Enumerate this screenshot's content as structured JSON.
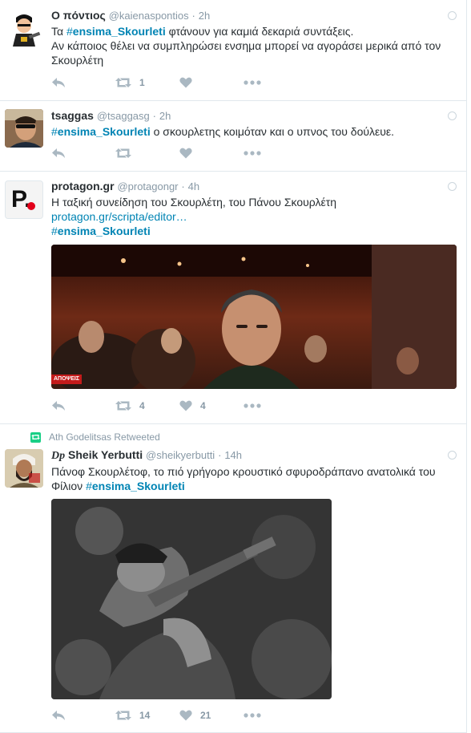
{
  "tweets": [
    {
      "name": "Ο πόντιος",
      "handle": "@kaienaspontios",
      "dot": "·",
      "time": "2h",
      "text_before": "Τα ",
      "hashtag_hash": "#",
      "hashtag": "ensima_Skourleti",
      "text_after": " φτάνουν για καμιά δεκαριά συντάξεις.",
      "text_line2": "Αν κάποιος θέλει να συμπληρώσει ενσημα μπορεί να αγοράσει μερικά από τον Σκουρλέτη",
      "retweets": "1",
      "likes": ""
    },
    {
      "name": "tsaggas",
      "handle": "@tsaggasg",
      "dot": "·",
      "time": "2h",
      "hashtag_hash": "#",
      "hashtag": "ensima_Skourleti",
      "text_after": " ο σκουρλετης κοιμόταν και ο υπνος του δούλευε.",
      "retweets": "",
      "likes": ""
    },
    {
      "name": "protagon.gr",
      "handle": "@protagongr",
      "dot": "·",
      "time": "4h",
      "text_line1": "Η ταξική συνείδηση του Σκουρλέτη, του Πάνου Σκουρλέτη",
      "link": "protagon.gr/scripta/editor…",
      "hashtag_hash": "#",
      "hashtag": "ensima_Skourleti",
      "image_badge": "ΑΠΟΨΕΙΣ",
      "retweets": "4",
      "likes": "4"
    },
    {
      "retweeted_by": "Ath Godelitsas Retweeted",
      "name_prefix": "Dp",
      "name": "Sheik Yerbutti",
      "handle": "@sheikyerbutti",
      "dot": "·",
      "time": "14h",
      "text_before": "Πάνοφ Σκουρλέτοφ, το πιό γρήγορο κρουστικό σφυροδράπανο ανατολικά του Φίλιον ",
      "hashtag_hash": "#",
      "hashtag": "ensima_Skourleti",
      "retweets": "14",
      "likes": "21"
    }
  ],
  "avatar_text": {
    "protagon": "P."
  },
  "colors": {
    "link": "#0084b4",
    "muted": "#8899a6",
    "retweet_green": "#19cf86"
  }
}
